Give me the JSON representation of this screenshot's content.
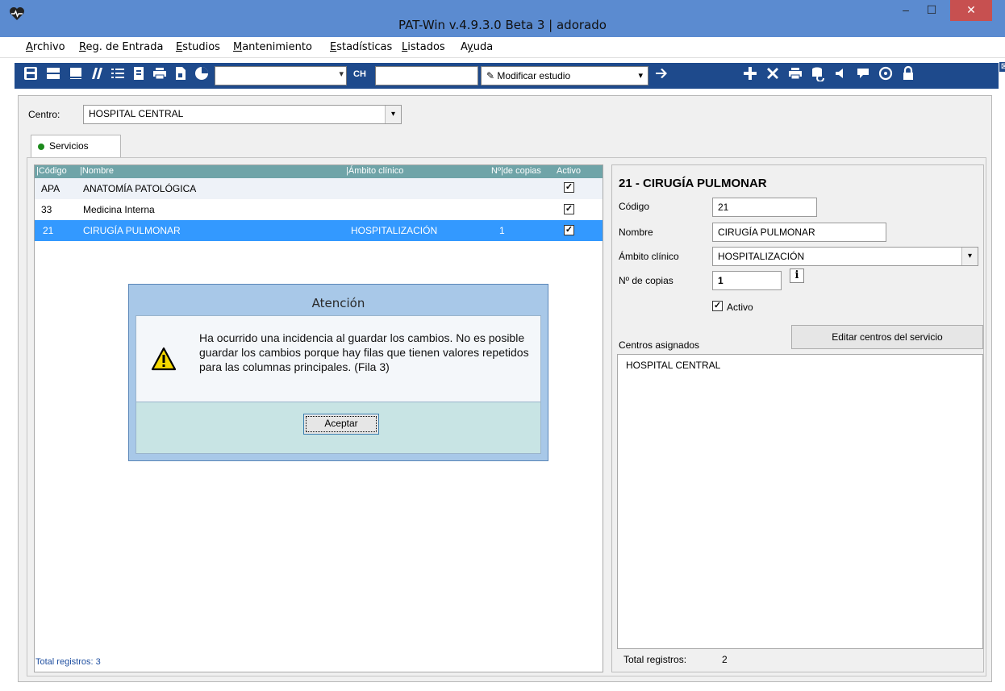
{
  "window": {
    "title": "PAT-Win v.4.9.3.0 Beta 3 | adorado",
    "app_icon": "heart-pulse-icon",
    "minimize": "–",
    "maximize": "☐",
    "close": "✕"
  },
  "menu": [
    {
      "label": "Archivo",
      "mnemonic": "A"
    },
    {
      "label": "Reg. de Entrada",
      "mnemonic": "R"
    },
    {
      "label": "Estudios",
      "mnemonic": "E"
    },
    {
      "label": "Mantenimiento",
      "mnemonic": "M"
    },
    {
      "label": "Estadísticas",
      "mnemonic": "E"
    },
    {
      "label": "Listados",
      "mnemonic": "L"
    },
    {
      "label": "Ayuda",
      "mnemonic": "y"
    }
  ],
  "toolbar": {
    "ch_label": "CH",
    "modify_study_label": "Modificar estudio",
    "close_box": "⊠"
  },
  "centro": {
    "label": "Centro:",
    "value": "HOSPITAL CENTRAL"
  },
  "tab": {
    "label": "Servicios"
  },
  "grid": {
    "columns": [
      "|Código",
      "|Nombre",
      "|Ámbito clínico",
      "Nº|de copias",
      "Activo"
    ],
    "rows": [
      {
        "codigo": "APA",
        "nombre": "ANATOMÍA PATOLÓGICA",
        "ambito": "",
        "copias": "",
        "activo": true
      },
      {
        "codigo": "33",
        "nombre": "Medicina Interna",
        "ambito": "",
        "copias": "",
        "activo": true
      },
      {
        "codigo": "21",
        "nombre": "CIRUGÍA PULMONAR",
        "ambito": "HOSPITALIZACIÓN",
        "copias": "1",
        "activo": true
      }
    ],
    "total": "Total registros: 3"
  },
  "detail": {
    "header": "21 - CIRUGÍA PULMONAR",
    "codigo_label": "Código",
    "codigo_value": "21",
    "nombre_label": "Nombre",
    "nombre_value": "CIRUGÍA PULMONAR",
    "ambito_label": "Ámbito clínico",
    "ambito_value": "HOSPITALIZACIÓN",
    "copias_label": "Nº de copias",
    "copias_value": "1",
    "info_glyph": "i",
    "activo_label": "Activo",
    "edit_button": "Editar centros del servicio",
    "centros_label": "Centros asignados",
    "centros": [
      "HOSPITAL CENTRAL"
    ],
    "total_label": "Total registros:",
    "total_value": "2"
  },
  "dialog": {
    "title": "Atención",
    "message": "Ha ocurrido una incidencia al guardar los cambios. No es posible guardar los cambios porque hay filas que tienen valores repetidos para las columnas principales. (Fila 3)",
    "ok_label": "Aceptar"
  }
}
